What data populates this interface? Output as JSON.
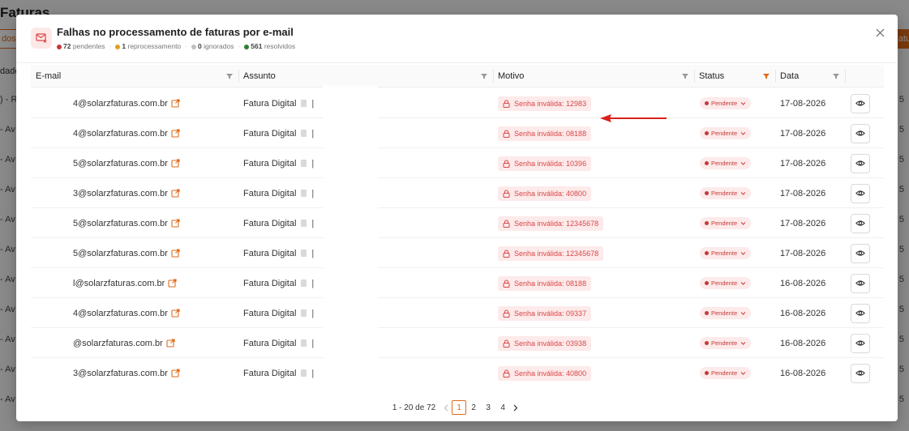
{
  "background": {
    "page_title": "Faturas",
    "tab_left": "dos",
    "tab_right": "Fatu",
    "col_header": "dade",
    "rows_left": [
      ") - R",
      "- Av",
      "- Av",
      "- Av",
      "- Av",
      "- Av",
      "- Av",
      "- Av",
      "- Av",
      "- Av",
      "- Av"
    ],
    "rows_right": [
      "5",
      "5",
      "5",
      "5",
      "5",
      "5",
      "5",
      "5",
      "5",
      "5",
      "5"
    ]
  },
  "modal": {
    "title": "Falhas no processamento de faturas por e-mail",
    "stats": [
      {
        "count": "72",
        "label": "pendentes",
        "color": "#c53a3a"
      },
      {
        "count": "1",
        "label": "reprocessamento",
        "color": "#e0a020"
      },
      {
        "count": "0",
        "label": "ignorados",
        "color": "#c0c0c0"
      },
      {
        "count": "561",
        "label": "resolvidos",
        "color": "#2e7d32"
      }
    ],
    "stat_separator": "·"
  },
  "table": {
    "columns": [
      "E-mail",
      "Assunto",
      "Motivo",
      "Status",
      "Data"
    ],
    "rows": [
      {
        "email": "4@solarzfaturas.com.br",
        "subject": "Fatura Digital",
        "reason": "Senha inválida: 12983",
        "status": "Pendente",
        "date": "17-08-2026"
      },
      {
        "email": "4@solarzfaturas.com.br",
        "subject": "Fatura Digital",
        "reason": "Senha inválida: 08188",
        "status": "Pendente",
        "date": "17-08-2026"
      },
      {
        "email": "5@solarzfaturas.com.br",
        "subject": "Fatura Digital",
        "reason": "Senha inválida: 10396",
        "status": "Pendente",
        "date": "17-08-2026"
      },
      {
        "email": "3@solarzfaturas.com.br",
        "subject": "Fatura Digital",
        "reason": "Senha inválida: 40800",
        "status": "Pendente",
        "date": "17-08-2026"
      },
      {
        "email": "5@solarzfaturas.com.br",
        "subject": "Fatura Digital",
        "reason": "Senha inválida: 12345678",
        "status": "Pendente",
        "date": "17-08-2026"
      },
      {
        "email": "5@solarzfaturas.com.br",
        "subject": "Fatura Digital",
        "reason": "Senha inválida: 12345678",
        "status": "Pendente",
        "date": "17-08-2026"
      },
      {
        "email": "l@solarzfaturas.com.br",
        "subject": "Fatura Digital",
        "reason": "Senha inválida: 08188",
        "status": "Pendente",
        "date": "16-08-2026"
      },
      {
        "email": "4@solarzfaturas.com.br",
        "subject": "Fatura Digital",
        "reason": "Senha inválida: 09337",
        "status": "Pendente",
        "date": "16-08-2026"
      },
      {
        "email": "@solarzfaturas.com.br",
        "subject": "Fatura Digital",
        "reason": "Senha inválida: 03938",
        "status": "Pendente",
        "date": "16-08-2026"
      },
      {
        "email": "3@solarzfaturas.com.br",
        "subject": "Fatura Digital",
        "reason": "Senha inválida: 40800",
        "status": "Pendente",
        "date": "16-08-2026"
      }
    ]
  },
  "pagination": {
    "range": "1 - 20 de 72",
    "pages": [
      "1",
      "2",
      "3",
      "4"
    ],
    "current": "1"
  },
  "colors": {
    "accent": "#e06a1a",
    "danger": "#d94848",
    "annotation_arrow": "#d9211b"
  }
}
